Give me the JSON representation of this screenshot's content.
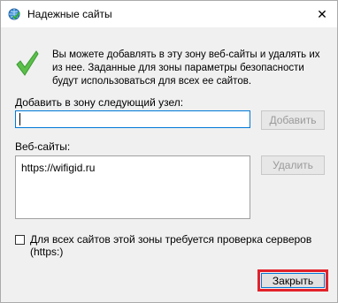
{
  "window": {
    "title": "Надежные сайты",
    "close_glyph": "✕",
    "highlight_color": "#e2222a",
    "accent_color": "#0078d7"
  },
  "info": {
    "text": "Вы можете добавлять в эту зону  веб-сайты и удалять их из нее. Заданные для зоны параметры безопасности будут использоваться для всех ее сайтов."
  },
  "add_site": {
    "label": "Добавить в зону следующий узел:",
    "value": "",
    "button_label": "Добавить"
  },
  "websites": {
    "label": "Веб-сайты:",
    "items": [
      "https://wifigid.ru"
    ],
    "remove_label": "Удалить"
  },
  "verification": {
    "label": "Для всех сайтов этой зоны требуется проверка серверов (https:)",
    "checked": false
  },
  "footer": {
    "close_label": "Закрыть"
  },
  "icons": {
    "title": "globe-check-icon",
    "info": "green-check-icon"
  }
}
